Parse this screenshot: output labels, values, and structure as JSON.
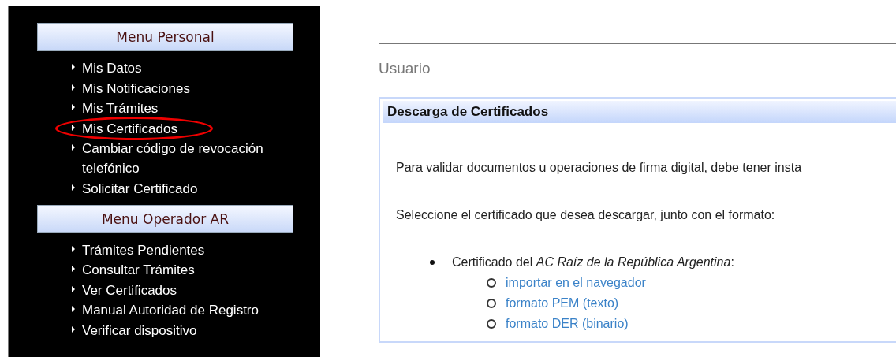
{
  "sidebar": {
    "menus": [
      {
        "title": "Menu Personal",
        "items": [
          {
            "label": "Mis Datos",
            "circled": false
          },
          {
            "label": "Mis Notificaciones",
            "circled": false
          },
          {
            "label": "Mis Trámites",
            "circled": false
          },
          {
            "label": "Mis Certificados",
            "circled": true
          },
          {
            "label": "Cambiar código de revocación telefónico",
            "circled": false
          },
          {
            "label": "Solicitar Certificado",
            "circled": false
          }
        ]
      },
      {
        "title": "Menu Operador AR",
        "items": [
          {
            "label": "Trámites Pendientes",
            "circled": false
          },
          {
            "label": "Consultar Trámites",
            "circled": false
          },
          {
            "label": "Ver Certificados",
            "circled": false
          },
          {
            "label": "Manual Autoridad de Registro",
            "circled": false
          },
          {
            "label": "Verificar dispositivo",
            "circled": false
          }
        ]
      }
    ]
  },
  "content": {
    "section_title": "Usuario",
    "panel": {
      "title": "Descarga de Certificados",
      "paragraphs": [
        "Para validar documentos u operaciones de firma digital, debe tener insta",
        "Seleccione el certificado que desea descargar, junto con el formato:"
      ],
      "certificates": [
        {
          "label": "Certificado del *AC Raíz de la República Argentina*:",
          "links": [
            "importar en el navegador",
            "formato PEM (texto)",
            "formato DER (binario)"
          ]
        }
      ]
    }
  }
}
